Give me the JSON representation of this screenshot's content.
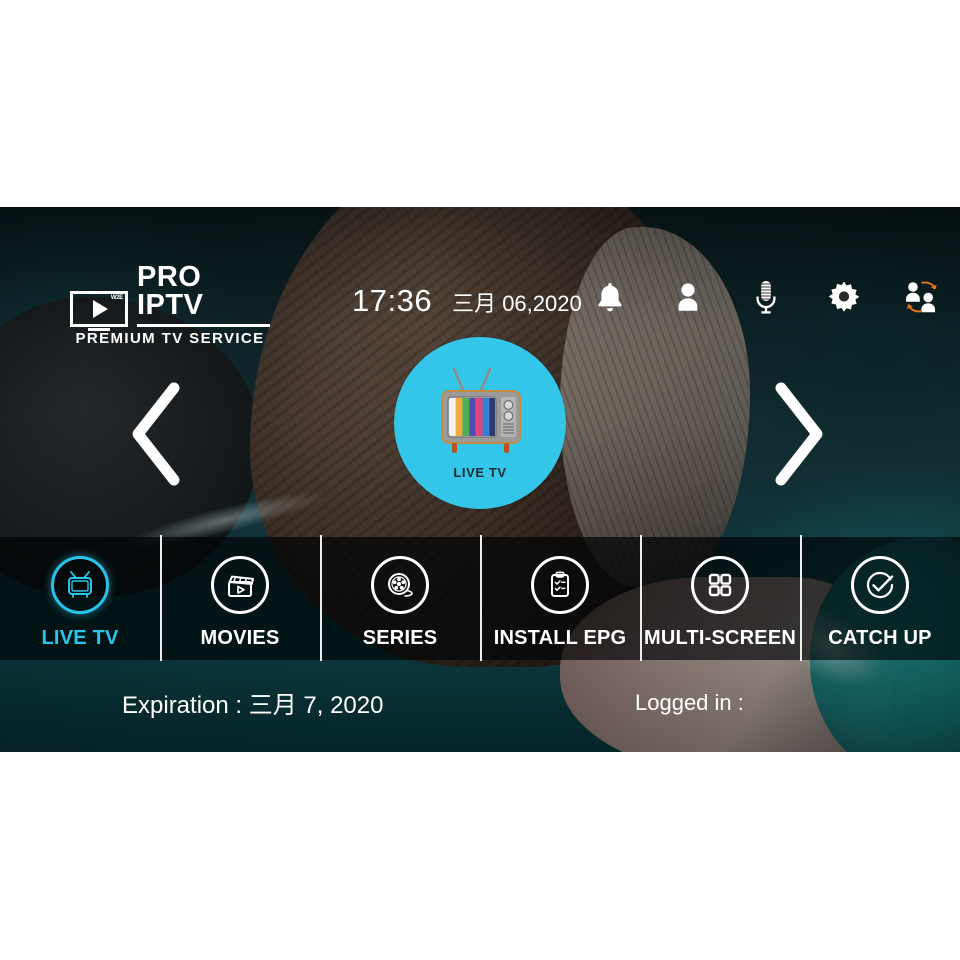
{
  "app": {
    "brand_name": "PRO IPTV",
    "brand_tagline": "PREMIUM TV SERVICE",
    "brand_badge": "W2E",
    "accent_color": "#29c5e8",
    "hero_circle_color": "#34c6e8"
  },
  "header": {
    "time": "17:36",
    "date": "三月 06,2020",
    "icons": [
      {
        "name": "bell-icon",
        "label": "Notifications"
      },
      {
        "name": "user-icon",
        "label": "Account"
      },
      {
        "name": "microphone-icon",
        "label": "Voice Search"
      },
      {
        "name": "gear-icon",
        "label": "Settings"
      },
      {
        "name": "switch-user-icon",
        "label": "Switch User"
      }
    ]
  },
  "carousel": {
    "prev_icon": "chevron-left-icon",
    "next_icon": "chevron-right-icon",
    "hero": {
      "label": "LIVE TV",
      "icon": "retro-tv-icon"
    }
  },
  "menu": {
    "items": [
      {
        "label": "LIVE TV",
        "icon": "tv-icon",
        "active": true
      },
      {
        "label": "MOVIES",
        "icon": "clapperboard-icon",
        "active": false
      },
      {
        "label": "SERIES",
        "icon": "film-reel-icon",
        "active": false
      },
      {
        "label": "INSTALL EPG",
        "icon": "clipboard-icon",
        "active": false
      },
      {
        "label": "MULTI-SCREEN",
        "icon": "grid-icon",
        "active": false
      },
      {
        "label": "CATCH UP",
        "icon": "check-circle-icon",
        "active": false
      }
    ]
  },
  "footer": {
    "expiration": "Expiration : 三月 7, 2020",
    "logged_in": "Logged in :"
  }
}
